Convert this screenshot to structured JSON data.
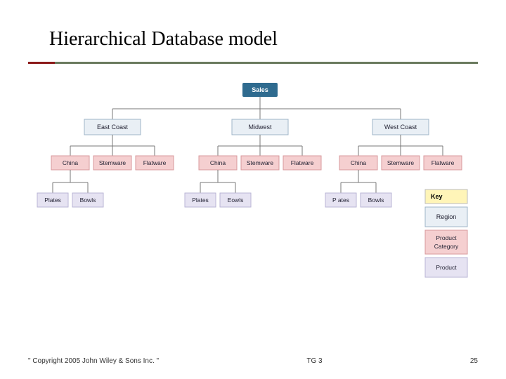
{
  "title": "Hierarchical Database model",
  "top": "Sales",
  "regions": [
    "East Coast",
    "Midwest",
    "West Coast"
  ],
  "categories": [
    "China",
    "Stemware",
    "Flatware"
  ],
  "products": [
    "Plates",
    "Bowls"
  ],
  "products_r2": [
    "Plates",
    "Eowls"
  ],
  "products_r3": [
    "P ates",
    "Bowls"
  ],
  "key": {
    "header": "Key",
    "region": "Region",
    "category": "Product Category",
    "product": "Product"
  },
  "footer": {
    "copyright": "\" Copyright 2005 John Wiley & Sons Inc. \"",
    "center": "TG 3",
    "page": "25"
  }
}
